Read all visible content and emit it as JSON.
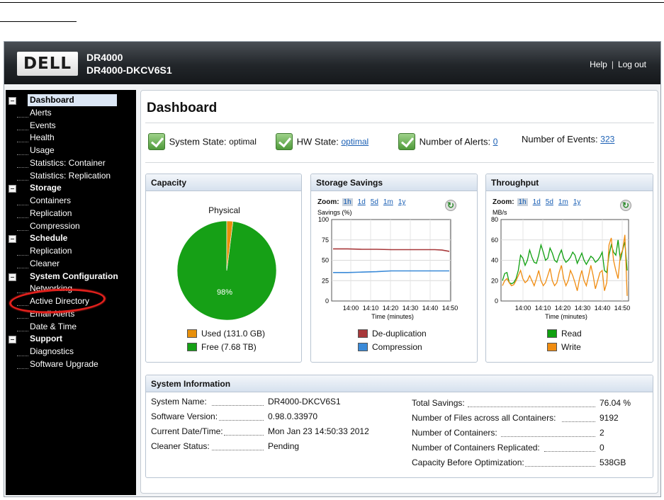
{
  "header": {
    "logo": "DELL",
    "product": "DR4000",
    "hostname": "DR4000-DKCV6S1",
    "help": "Help",
    "separator": "|",
    "logout": "Log out"
  },
  "nav": [
    {
      "label": "Dashboard",
      "section": true,
      "selected": true
    },
    {
      "label": "Alerts"
    },
    {
      "label": "Events"
    },
    {
      "label": "Health"
    },
    {
      "label": "Usage"
    },
    {
      "label": "Statistics: Container"
    },
    {
      "label": "Statistics: Replication"
    },
    {
      "label": "Storage",
      "section": true
    },
    {
      "label": "Containers"
    },
    {
      "label": "Replication"
    },
    {
      "label": "Compression"
    },
    {
      "label": "Schedule",
      "section": true
    },
    {
      "label": "Replication"
    },
    {
      "label": "Cleaner"
    },
    {
      "label": "System Configuration",
      "section": true
    },
    {
      "label": "Networking"
    },
    {
      "label": "Active Directory",
      "highlighted": true
    },
    {
      "label": "Email Alerts"
    },
    {
      "label": "Date & Time"
    },
    {
      "label": "Support",
      "section": true
    },
    {
      "label": "Diagnostics"
    },
    {
      "label": "Software Upgrade"
    }
  ],
  "dashboard": {
    "title": "Dashboard",
    "system_state_label": "System State:",
    "system_state_value": "optimal",
    "hw_state_label": "HW State:",
    "hw_state_value": "optimal",
    "alerts_label": "Number of Alerts:",
    "alerts_value": "0",
    "events_label": "Number of Events:",
    "events_value": "323"
  },
  "capacity": {
    "title": "Capacity",
    "chart_title": "Physical",
    "percent_label": "98%",
    "used_label": "Used (131.0 GB)",
    "free_label": "Free (7.68 TB)",
    "used_color": "#e8900c",
    "free_color": "#16a016"
  },
  "zoom": {
    "label": "Zoom:",
    "options": [
      "1h",
      "1d",
      "5d",
      "1m",
      "1y"
    ]
  },
  "savings": {
    "title": "Storage Savings",
    "ylabel": "Savings (%)",
    "xlabel": "Time (minutes)",
    "legend_dedup": "De-duplication",
    "legend_compression": "Compression"
  },
  "throughput": {
    "title": "Throughput",
    "ylabel": "MB/s",
    "xlabel": "Time (minutes)",
    "legend_read": "Read",
    "legend_write": "Write"
  },
  "sysinfo": {
    "title": "System Information",
    "left": [
      {
        "k": "System Name:",
        "v": "DR4000-DKCV6S1"
      },
      {
        "k": "Software Version:",
        "v": "0.98.0.33970"
      },
      {
        "k": "Current Date/Time:",
        "v": "Mon Jan 23 14:50:33 2012"
      },
      {
        "k": "Cleaner Status:",
        "v": "Pending"
      }
    ],
    "right": [
      {
        "k": "Total Savings:",
        "v": "76.04 %"
      },
      {
        "k": "Number of Files across all Containers:",
        "v": "9192"
      },
      {
        "k": "Number of Containers:",
        "v": "2"
      },
      {
        "k": "Number of Containers Replicated:",
        "v": "0"
      },
      {
        "k": "Capacity Before Optimization:",
        "v": "538GB"
      }
    ]
  },
  "chart_data": [
    {
      "type": "pie",
      "title": "Physical",
      "categories": [
        "Used (131.0 GB)",
        "Free (7.68 TB)"
      ],
      "values": [
        2,
        98
      ],
      "colors": [
        "#e8900c",
        "#16a016"
      ]
    },
    {
      "type": "line",
      "ylabel": "Savings (%)",
      "xlabel": "Time (minutes)",
      "ylim": [
        0,
        100
      ],
      "yticks": [
        0,
        25,
        50,
        75,
        100
      ],
      "xticks": [
        "14:00",
        "14:10",
        "14:20",
        "14:30",
        "14:40",
        "14:50"
      ],
      "x": [
        0,
        10,
        20,
        30,
        40,
        50,
        60,
        70,
        75,
        80
      ],
      "series": [
        {
          "name": "De-duplication",
          "color": "#a8383a",
          "values": [
            64,
            64,
            63.5,
            63.5,
            63,
            63,
            63,
            63,
            62.5,
            61
          ]
        },
        {
          "name": "Compression",
          "color": "#3a8ad8",
          "values": [
            35,
            35,
            35.5,
            36,
            37,
            37,
            37,
            37,
            37,
            37
          ]
        }
      ]
    },
    {
      "type": "line",
      "ylabel": "MB/s",
      "xlabel": "Time (minutes)",
      "ylim": [
        0,
        80
      ],
      "yticks": [
        0,
        20,
        40,
        60,
        80
      ],
      "xticks": [
        "14:00",
        "14:10",
        "14:20",
        "14:30",
        "14:40",
        "14:50"
      ],
      "series": [
        {
          "name": "Read",
          "color": "#10a010",
          "values": [
            20,
            27,
            28,
            18,
            17,
            18,
            22,
            30,
            45,
            42,
            35,
            40,
            50,
            43,
            38,
            37,
            45,
            55,
            48,
            40,
            42,
            52,
            47,
            40,
            38,
            45,
            50,
            42,
            38,
            40,
            43,
            48,
            45,
            37,
            42,
            47,
            40,
            36,
            40,
            44,
            42,
            38,
            40,
            43,
            48,
            30,
            28,
            45,
            55,
            48,
            45,
            60,
            40,
            50,
            58,
            30
          ]
        },
        {
          "name": "Write",
          "color": "#f08c10",
          "values": [
            15,
            20,
            22,
            18,
            15,
            16,
            20,
            25,
            30,
            22,
            18,
            20,
            25,
            20,
            15,
            22,
            30,
            20,
            15,
            18,
            25,
            32,
            20,
            15,
            18,
            28,
            35,
            22,
            15,
            20,
            30,
            25,
            18,
            10,
            22,
            30,
            20,
            15,
            25,
            35,
            25,
            12,
            20,
            28,
            30,
            10,
            18,
            55,
            62,
            40,
            30,
            22,
            45,
            50,
            65,
            5
          ]
        }
      ]
    }
  ]
}
